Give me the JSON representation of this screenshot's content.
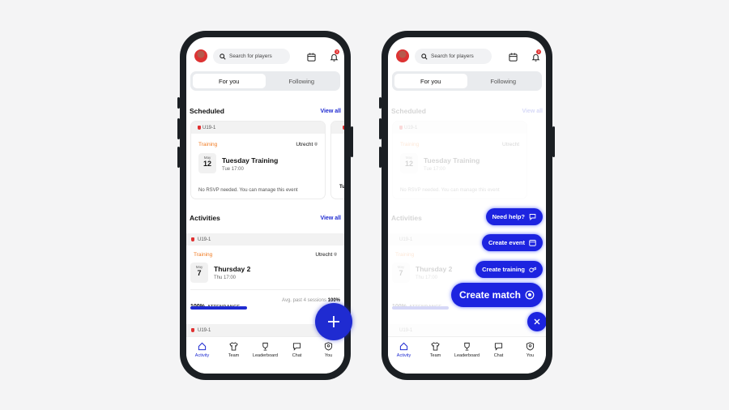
{
  "topbar": {
    "search_placeholder": "Search for players",
    "notification_count": "3"
  },
  "segment": {
    "for_you": "For you",
    "following": "Following"
  },
  "scheduled": {
    "title": "Scheduled",
    "view_all": "View all",
    "card": {
      "team": "U19-1",
      "type": "Training",
      "location": "Utrecht",
      "month": "May",
      "day": "12",
      "title": "Tuesday Training",
      "time": "Tue 17:00",
      "footer": "No RSVP needed. You can manage this event"
    },
    "peek_title": "Tu"
  },
  "activities": {
    "title": "Activities",
    "view_all": "View all",
    "item": {
      "team": "U19-1",
      "type": "Training",
      "location": "Utrecht",
      "month": "May",
      "day": "7",
      "title": "Thursday 2",
      "time": "Thu 17:00"
    },
    "attendance_pct": "100%",
    "attendance_label": "ATTENDANCE",
    "attendance_avg": "Avg. past 4 sessions",
    "attendance_avg_value": "100%",
    "attendance_fill": 0.45,
    "next_team": "U19-1"
  },
  "tabbar": [
    "Activity",
    "Team",
    "Leaderboard",
    "Chat",
    "You"
  ],
  "fab_menu": {
    "need_help": "Need help?",
    "create_event": "Create event",
    "create_training": "Create training",
    "create_match": "Create match"
  },
  "colors": {
    "primary": "#1f2bd1",
    "accent_orange": "#f07a21",
    "badge_red": "#e03131"
  },
  "icons": [
    "search-icon",
    "calendar-icon",
    "bell-icon",
    "location-pin-icon",
    "home-icon",
    "shirt-icon",
    "trophy-icon",
    "chat-bubble-icon",
    "shield-user-icon",
    "plus-icon",
    "close-icon",
    "ball-icon"
  ]
}
